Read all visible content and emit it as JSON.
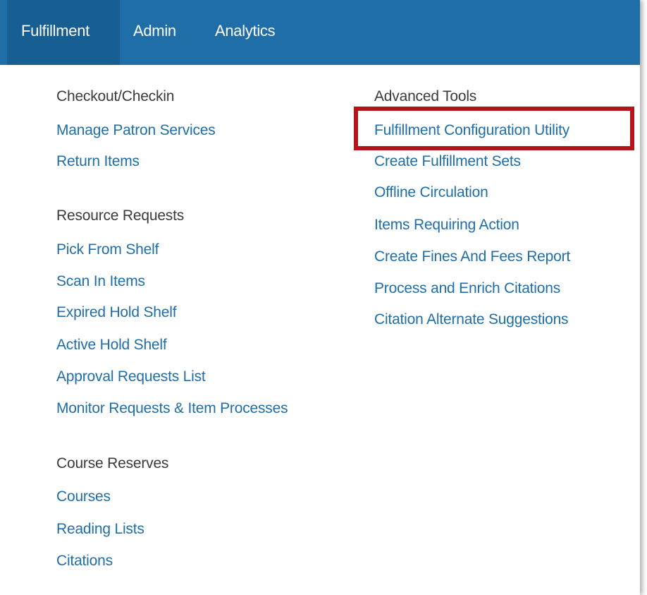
{
  "nav": {
    "tabs": [
      "Fulfillment",
      "Admin",
      "Analytics"
    ],
    "active_tab": "Fulfillment"
  },
  "menu": {
    "checkout": {
      "title": "Checkout/Checkin",
      "items": [
        "Manage Patron Services",
        "Return Items"
      ]
    },
    "resource_requests": {
      "title": "Resource Requests",
      "items": [
        "Pick From Shelf",
        "Scan In Items",
        "Expired Hold Shelf",
        "Active Hold Shelf",
        "Approval Requests List",
        "Monitor Requests & Item Processes"
      ]
    },
    "course_reserves": {
      "title": "Course Reserves",
      "items": [
        "Courses",
        "Reading Lists",
        "Citations"
      ]
    },
    "advanced_tools": {
      "title": "Advanced Tools",
      "items": [
        "Fulfillment Configuration Utility",
        "Create Fulfillment Sets",
        "Offline Circulation",
        "Items Requiring Action",
        "Create Fines And Fees Report",
        "Process and Enrich Citations",
        "Citation Alternate Suggestions"
      ]
    }
  },
  "colors": {
    "nav_bg": "#1f6ea8",
    "nav_active_bg": "#175e92",
    "link": "#1f6ea8",
    "highlight": "#b5141b"
  }
}
